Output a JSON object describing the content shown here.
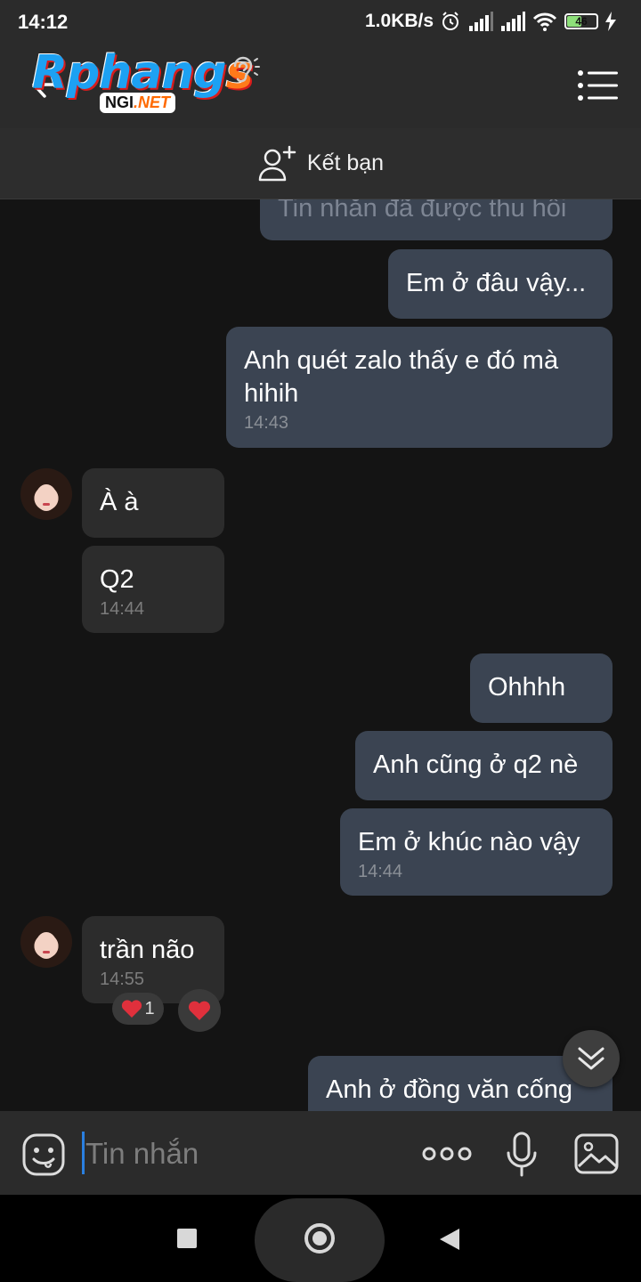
{
  "status_bar": {
    "time": "14:12",
    "network_speed": "1.0KB/s",
    "battery_level": "46",
    "icons": [
      "alarm-icon",
      "signal-icon",
      "signal-icon",
      "wifi-icon",
      "battery-icon",
      "charging-icon"
    ]
  },
  "header": {
    "logo_brand": "Rphang",
    "logo_brand_tail": "s",
    "logo_sub_left": "NGI",
    "logo_sub_right": ".NET"
  },
  "friend_bar": {
    "label": "Kết bạn"
  },
  "messages": [
    {
      "dir": "out",
      "text": "Tin nhắn đã được thu hồi"
    },
    {
      "dir": "out",
      "text": "Em ở đâu vậy..."
    },
    {
      "dir": "out",
      "text_line1": "Anh quét zalo thấy e đó mà",
      "text_line2": "hihih",
      "time": "14:43"
    },
    {
      "dir": "in",
      "text": "À à"
    },
    {
      "dir": "in",
      "text": "Q2",
      "time": "14:44"
    },
    {
      "dir": "out",
      "text": "Ohhhh"
    },
    {
      "dir": "out",
      "text": "Anh cũng ở q2 nè"
    },
    {
      "dir": "out",
      "text": "Em ở khúc nào vậy",
      "time": "14:44"
    },
    {
      "dir": "in",
      "text": "trần não",
      "time": "14:55",
      "reaction_count": "1"
    },
    {
      "dir": "out",
      "text": "Anh ở đồng văn cống"
    }
  ],
  "input_bar": {
    "placeholder": "Tin nhắn"
  },
  "colors": {
    "outgoing_bubble": "#3b4452",
    "incoming_bubble": "#2c2c2c",
    "background": "#141414",
    "cursor": "#2a7fe0",
    "heart": "#e0303c"
  }
}
